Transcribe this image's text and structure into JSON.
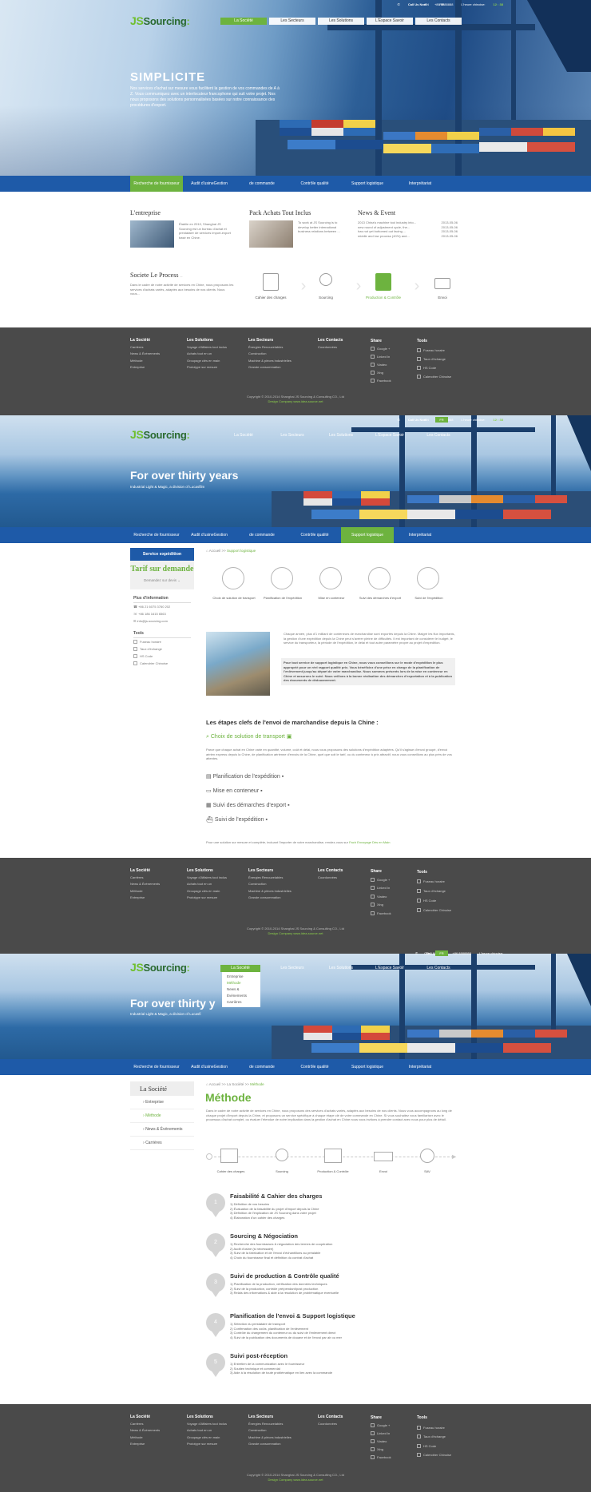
{
  "common": {
    "call_us": "Call Us Now",
    "phone": "+86 8888888",
    "china_time_label": "L'heure chinoise:",
    "china_time": "12 : 38",
    "lang_cn": "CN",
    "lang_fr": "FR",
    "logo_js": "JS",
    "logo_text": "Sourcing",
    "main_nav": [
      "La Société",
      "Les Secteurs",
      "Les Solutions",
      "L'Espace Savoir",
      "Les Contacts"
    ],
    "sub_nav": [
      "Recherche de fournisseur",
      "Audit d'usineGestion",
      "de commande",
      "Contrôle qualité",
      "Support logistique",
      "Interprétariat"
    ]
  },
  "section1": {
    "hero_title": "SIMPLICITE",
    "hero_text": "Nos services d'achat sur mesure vous facilitent la gestion de vos commandes de A à Z. Vous communiquez avec un interlocuteur francophone qui suit votre projet. Nos nous proposons des solutions personnalisées basées sur notre connaissance des procédures d'export.",
    "entreprise_title": "L'entreprise",
    "entreprise_text": "Établie en 2010, Shanghai JS Sourcing est un bureau d'achat et prestataire de services import-export basé en Chine.",
    "pack_title": "Pack Achats Tout Inclus",
    "pack_text": "To work at JS Sourcing is to develop better international business relations between ...",
    "news_title": "News & Event",
    "news": [
      {
        "text": "2013 China's machine tool industry into...",
        "date": "2013-05-06"
      },
      {
        "text": "new round of adjustment cycle, the...",
        "date": "2013-05-06"
      },
      {
        "text": "has not yet bottomed out facing ...",
        "date": "2013-05-06"
      },
      {
        "text": "middle and low process (40%) and...",
        "date": "2013-05-06"
      }
    ],
    "process_title": "Societe Le Process",
    "process_more": "...",
    "process_text": "Dans le cadre de notre activité de services en Chine, nous proposons les services d'achats variés, adaptés aux besoins de nos clients. Nous vous...",
    "steps": [
      "Cahier des charges",
      "Sourcing",
      "Production & Contrôle",
      "Envoi"
    ]
  },
  "section2": {
    "hero_title": "For over thirty years",
    "hero_text": "Industrial Light & Magic, a division of Lucasfilm",
    "side_head": "Service expédition",
    "tarif_title": "Tarif sur demande",
    "tarif_link": "Demandez sur devis",
    "info_title": "Plus d'information",
    "phone1": "+86 21 6075 3760 202",
    "phone2": "+86 186 1615 6563",
    "email": "info@js-sourcing.com",
    "tools_title": "Tools",
    "tools": [
      "Fuseau horaire",
      "Taux d'échange",
      "HS Code",
      "Calendrier Chinoise"
    ],
    "breadcrumb_home": "Accueil",
    "breadcrumb_sep": ">>",
    "breadcrumb_current": "Support logistique",
    "ship_steps": [
      "Choix de solution de transport",
      "Planification de l'expédition",
      "Mise en conteneur",
      "Suivi des démarches d'export",
      "Suivi de l'expédition"
    ],
    "intro": "Chaque année, plus d'1 milliard de conteneurs de marchandise sont exportés depuis la Chine. Malgré les flux importants, la gestion d'une expédition depuis la Chine peut s'avérer pleine de difficultés. Il est important de considérer le budget, le service du transporteur, la période de l'expédition, le délai et tout autre paramètre propre au projet d'expédition.",
    "intro_bold": "Pour tout service de support logistique en Chine, nous vous conseillons sur le mode d'expédition le plus approprié pour un réel rapport qualité prix. Vous bénéficiez d'une prise en charge de la planification de l'enlèvement jusqu'au départ de votre marchandise. Nous sommes présents lors de la mise en conteneur en Chine et assurons le suivi. Nous veillons à la bonne réalisation des démarches d'exportation et à la publication des documents de dédouanement.",
    "steps_title": "Les étapes clefs de l'envoi de marchandise depuis la Chine :",
    "step1": "Choix de solution de transport",
    "step1_text": "Parce que chaque achat en Chine varie en quantité, volume, coût et délai, nous vous proposons des solutions d'expédition adaptées. Qu'il s'agisse d'envoi groupé, d'envoi aérien express depuis la Chine, de planification aérienne d'envois de la Chine, quel que soit le tarif, ou du conteneur à prix attractif, nous vous conseillons au plus près de vos attentes.",
    "step2": "Planification de l'expédition",
    "step3": "Mise en conteneur",
    "step4": "Suivi des démarches d'export",
    "step5": "Suivi de l'expédition",
    "closing": "Pour une solution sur mesure et complète, incluant l'importer de votre marchandise, rendez-vous sur",
    "closing_link": "Fach Envoyage Dès en Main"
  },
  "section3": {
    "hero_title": "For over thirty y",
    "hero_text": "Industrial Light & Magic, a division of Lucasfi",
    "dropdown": [
      "Entreprise",
      "Méthode",
      "News & Évènements",
      "Carrières"
    ],
    "side_title": "La Société",
    "side_items": [
      "Entreprise",
      "Méthode",
      "News & Événements",
      "Carrières"
    ],
    "breadcrumb_home": "Accueil",
    "breadcrumb_mid": "La Société",
    "breadcrumb_current": "Méthode",
    "title": "Méthode",
    "intro": "Dans le cadre de notre activité de services en Chine, nous proposons des services d'achats variés, adaptés aux besoins de nos clients. Nous vous accompagnons au long de chaque projet d'import depuis la Chine, et proposons un service spécifique à chaque étape clé de votre commande en Chine. Si vous souhaitez vous familiariser avec le processus d'achat complet, ou évaluer l'étendue de notre implication dans la gestion d'achat en Chine nous vous invitons à prendre contact avec nous pour plus de détail.",
    "flow": [
      "Cahier des charges",
      "Sourcing",
      "Production & Contrôle",
      "Envoi",
      "SAV"
    ],
    "blocks": [
      {
        "n": "1",
        "title": "Faisabilité & Cahier des charges",
        "lines": [
          "1)  Définition de vos besoins",
          "2)  Évaluation de la faisabilité du projet d'import depuis la Chine",
          "3)  Définition de l'implication de JS Sourcing dans votre projet",
          "4)  Élaboration d'un cahier des charges"
        ]
      },
      {
        "n": "2",
        "title": "Sourcing & Négociation",
        "lines": [
          "1)  Recherche des fournisseurs & négociation des termes de coopération",
          "2)  Audit d'usine (si nécessaire)",
          "3)  Suivi de la fabrication et de l'envoi d'échantillons au préalable",
          "4)  Choix du fournisseur final et définition du contrat d'achat"
        ]
      },
      {
        "n": "3",
        "title": "Suivi de production & Contrôle qualité",
        "lines": [
          "1)  Planification de la production, vérification des données techniques",
          "2)  Suivi de la production, contrôle pré/pendant/post production",
          "3)  Relais des informations & aide à la résolution de problématique éventuelle"
        ]
      },
      {
        "n": "4",
        "title": "Planification de l'envoi & Support logistique",
        "lines": [
          "1)  Sélection du prestataire de transport",
          "2)  Confirmation des coûts, planification de l'enlèvement",
          "3)  Contrôle du chargement du conteneur ou du suivi de l'enlèvement direct",
          "4)  Suivi de la publication des documents de douane et de l'envoi par air ou mer"
        ]
      },
      {
        "n": "5",
        "title": "Suivi post-réception",
        "lines": [
          "1)  Entretien de la communication avec le fournisseur",
          "2)  Soutien technique et commercial",
          "3)  Aide à la résolution de toute problématique en lien avec la commande"
        ]
      }
    ]
  },
  "footer": {
    "col_societe_title": "La Société",
    "col_societe": [
      "Carrières",
      "News & Événements",
      "Méthode",
      "Entreprise"
    ],
    "col_solutions_title": "Les Solutions",
    "col_solutions": [
      "Voyage d'Affaires tout inclus",
      "Achats tout en un",
      "Groupage clés en main",
      "Prototype sur mesure"
    ],
    "col_secteurs_title": "Les Secteurs",
    "col_secteurs": [
      "Énergies Renouvelables",
      "Construction",
      "Machine & pièces industrielles",
      "Grande consommation"
    ],
    "col_contacts_title": "Les Contacts",
    "col_contacts": [
      "Coordonnées"
    ],
    "col_share_title": "Share",
    "col_share": [
      "Google +",
      "Linked In",
      "Viadeo",
      "Xing",
      "Facebook"
    ],
    "col_tools_title": "Tools",
    "col_tools": [
      "Fuseau horaire",
      "Taux d'échange",
      "HS Code",
      "Calendrier Chinoise"
    ],
    "copyright": "Copyright © 2010-2014 Shanghai JS Sourcing & Consulting CO., Ltd",
    "design": "Design Company www.idea-source.net"
  }
}
